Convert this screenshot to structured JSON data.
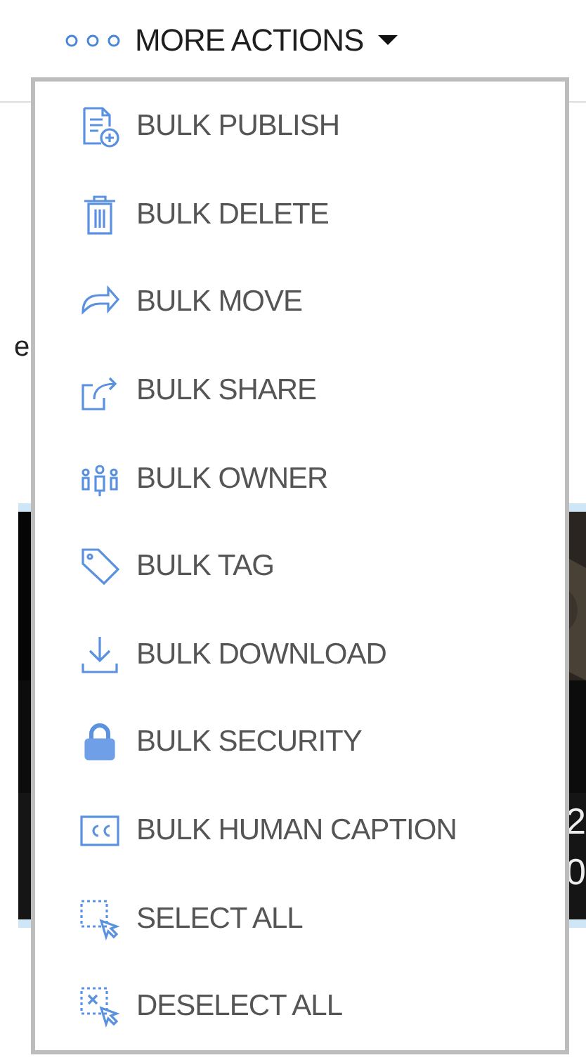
{
  "background": {
    "left_text": "e",
    "card": {
      "kind": "picture",
      "right_texts": [
        "2",
        "0"
      ]
    }
  },
  "menu_button": {
    "label": "MORE ACTIONS"
  },
  "menu_items": [
    {
      "label": "BULK PUBLISH"
    },
    {
      "label": "BULK DELETE"
    },
    {
      "label": "BULK MOVE"
    },
    {
      "label": "BULK SHARE"
    },
    {
      "label": "BULK OWNER"
    },
    {
      "label": "BULK TAG"
    },
    {
      "label": "BULK DOWNLOAD"
    },
    {
      "label": "BULK SECURITY"
    },
    {
      "label": "BULK HUMAN CAPTION"
    },
    {
      "label": "SELECT ALL"
    },
    {
      "label": "DESELECT ALL"
    }
  ]
}
